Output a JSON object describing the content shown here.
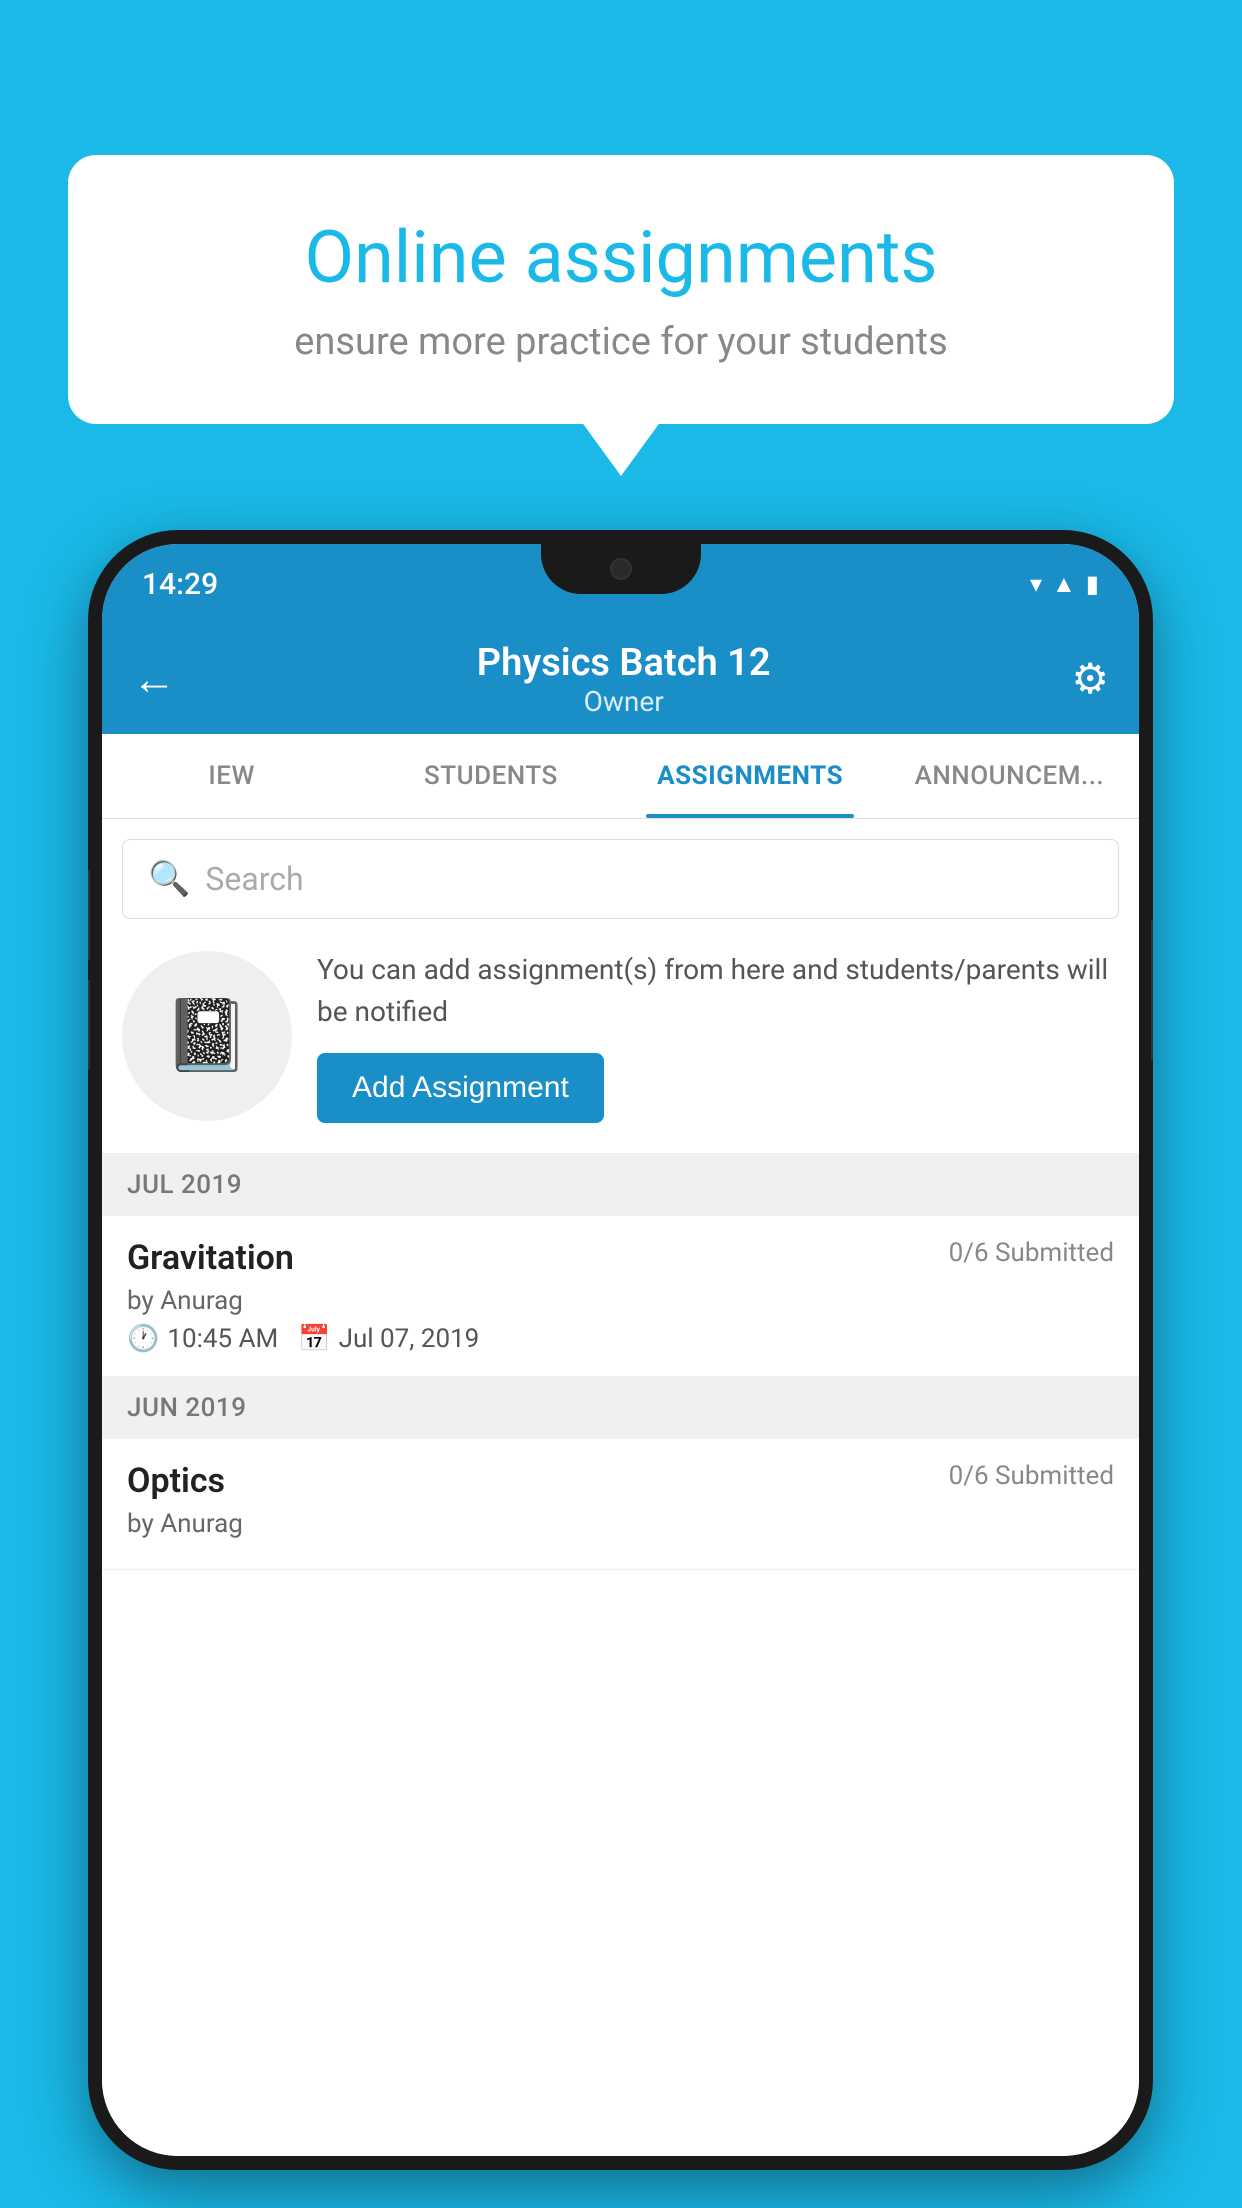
{
  "background_color": "#1ab9e8",
  "speech_bubble": {
    "title": "Online assignments",
    "subtitle": "ensure more practice for your students"
  },
  "phone": {
    "status_bar": {
      "time": "14:29",
      "icons": [
        "wifi",
        "signal",
        "battery"
      ]
    },
    "app_bar": {
      "title": "Physics Batch 12",
      "subtitle": "Owner",
      "back_label": "←",
      "settings_label": "⚙"
    },
    "tabs": [
      {
        "label": "IEW",
        "active": false
      },
      {
        "label": "STUDENTS",
        "active": false
      },
      {
        "label": "ASSIGNMENTS",
        "active": true
      },
      {
        "label": "ANNOUNCEM...",
        "active": false
      }
    ],
    "search": {
      "placeholder": "Search"
    },
    "promo": {
      "description": "You can add assignment(s) from here and students/parents will be notified",
      "button_label": "Add Assignment"
    },
    "sections": [
      {
        "header": "JUL 2019",
        "assignments": [
          {
            "title": "Gravitation",
            "submitted": "0/6 Submitted",
            "author": "by Anurag",
            "time": "10:45 AM",
            "date": "Jul 07, 2019"
          }
        ]
      },
      {
        "header": "JUN 2019",
        "assignments": [
          {
            "title": "Optics",
            "submitted": "0/6 Submitted",
            "author": "by Anurag",
            "time": "",
            "date": ""
          }
        ]
      }
    ]
  }
}
